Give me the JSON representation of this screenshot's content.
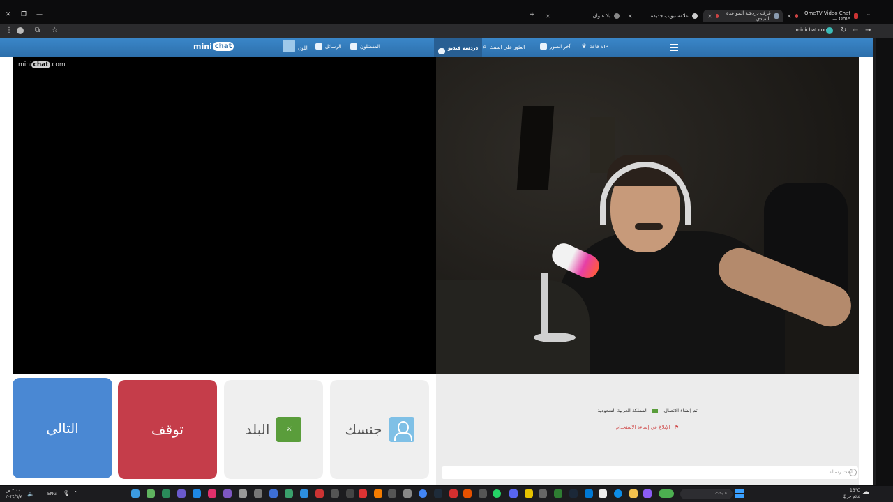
{
  "browser": {
    "tabs": [
      {
        "title": "OmeTV Video Chat — Ome",
        "active": false
      },
      {
        "title": "غرف دردشة المواعدة بالفيدي",
        "active": true
      },
      {
        "title": "علامة تبويب جديدة",
        "active": false
      },
      {
        "title": "بلا عنوان",
        "active": false
      }
    ],
    "url": "minichat.com"
  },
  "site": {
    "logo_left": "mini",
    "logo_right": "chat",
    "nav": {
      "vip": "VIP قاعة",
      "photos": "آخر الصور",
      "search_name": "العثور على اسمك",
      "video_chat": "دردشة فيديو",
      "favorites": "المفضلون",
      "messages": "الرسائل",
      "color": "اللون"
    },
    "watermark_left": "mini",
    "watermark_mid": "chat",
    "watermark_right": ".com"
  },
  "controls": {
    "next": "التالي",
    "stop": "توقف",
    "country": "البلد",
    "gender": "جنسك"
  },
  "chat": {
    "connected": "تم إنشاء الاتصال.",
    "country_name": "المملكة العربية السعودية",
    "report": "الإبلاغ عن إساءة الاستخدام",
    "input_placeholder": "ابعث رسالة"
  },
  "taskbar": {
    "search": "بحث",
    "lang": "ENG",
    "time": "٣:٠٠ ص",
    "date": "٢٠٢٤/٦/٧",
    "weather_temp": "13°C",
    "weather_desc": "غائم جزئيًا"
  },
  "colors": {
    "nav_blue": "#2d6fab",
    "next_blue": "#4a88d3",
    "stop_red": "#c53d4a",
    "flag_green": "#5a9d3b"
  }
}
